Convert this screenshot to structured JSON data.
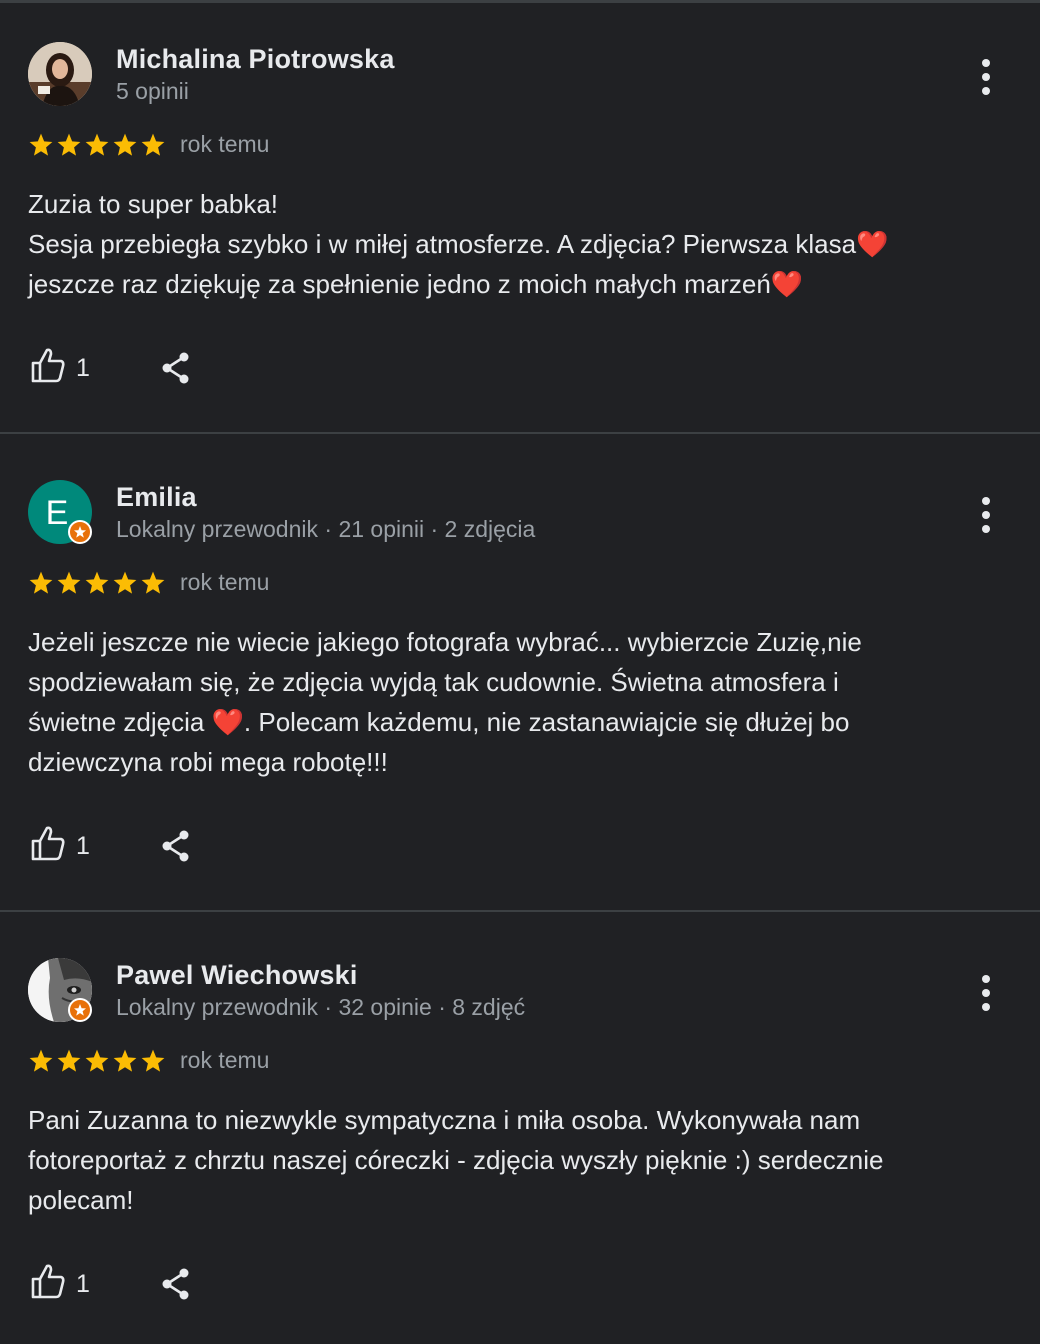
{
  "colors": {
    "background": "#202124",
    "star": "#fbbc04",
    "badge": "#e8710a",
    "text": "#e8eaed",
    "muted": "#9aa0a6"
  },
  "reviews": [
    {
      "name": "Michalina Piotrowska",
      "meta": "5 opinii",
      "rating": 5,
      "time": "rok temu",
      "text": "Zuzia to super babka!\nSesja przebiegła szybko i w miłej atmosferze. A zdjęcia? Pierwsza klasa❤️\njeszcze raz dziękuję za spełnienie jedno z moich małych marzeń❤️",
      "likes": "1",
      "avatar_type": "photo"
    },
    {
      "name": "Emilia",
      "meta": "Lokalny przewodnik · 21 opinii · 2 zdjęcia",
      "rating": 5,
      "time": "rok temu",
      "text": "Jeżeli jeszcze nie wiecie jakiego fotografa wybrać... wybierzcie Zuzię,nie\nspodziewałam się, że zdjęcia wyjdą tak cudownie. Świetna atmosfera i\nświetne zdjęcia ❤️. Polecam każdemu, nie zastanawiajcie się dłużej bo\ndziewczyna robi mega robotę!!!",
      "likes": "1",
      "avatar_letter": "E",
      "avatar_color": "#00897b"
    },
    {
      "name": "Pawel Wiechowski",
      "meta": "Lokalny przewodnik · 32 opinie · 8 zdjęć",
      "rating": 5,
      "time": "rok temu",
      "text": "Pani Zuzanna to niezwykle sympatyczna i miła osoba. Wykonywała nam\nfotoreportaż z chrztu naszej córeczki - zdjęcia wyszły pięknie :) serdecznie\npolecam!",
      "likes": "1",
      "avatar_type": "photo-bw"
    }
  ],
  "icons": {
    "like": "thumbs-up-icon",
    "share": "share-icon",
    "menu": "more-vert-icon",
    "star": "star-icon",
    "badge": "local-guide-badge-icon"
  }
}
